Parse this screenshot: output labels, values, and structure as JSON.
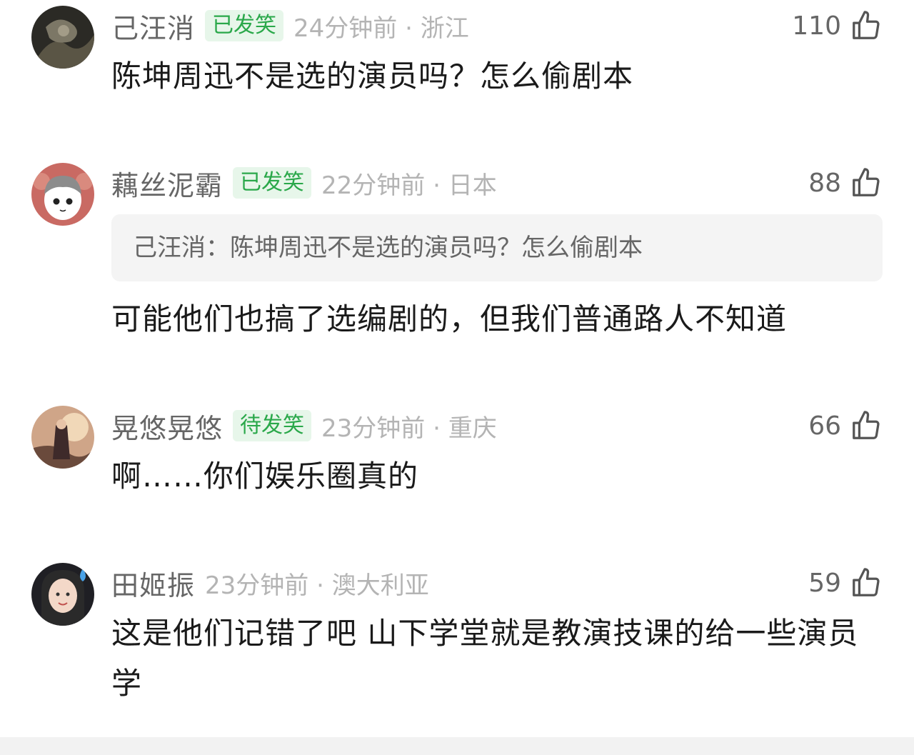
{
  "comments": [
    {
      "username": "己汪消",
      "badge": "已发笑",
      "time_location": "24分钟前 · 浙江",
      "likes": "110",
      "text": "陈坤周迅不是选的演员吗？怎么偷剧本"
    },
    {
      "username": "藕丝泥霸",
      "badge": "已发笑",
      "time_location": "22分钟前 · 日本",
      "likes": "88",
      "quote": "己汪消：陈坤周迅不是选的演员吗？怎么偷剧本",
      "text": "可能他们也搞了选编剧的，但我们普通路人不知道"
    },
    {
      "username": "晃悠晃悠",
      "badge": "待发笑",
      "time_location": "23分钟前 · 重庆",
      "likes": "66",
      "text": "啊……你们娱乐圈真的"
    },
    {
      "username": "田姬振",
      "time_location": "23分钟前 · 澳大利亚",
      "likes": "59",
      "text": "这是他们记错了吧 山下学堂就是教演技课的给一些演员学"
    }
  ],
  "colors": {
    "badge_green": "#2aa84a",
    "badge_bg": "#e7f6ea",
    "meta_gray": "#b4b4b4",
    "username_gray": "#666666"
  },
  "icons": {
    "like": "thumbs-up-icon"
  }
}
